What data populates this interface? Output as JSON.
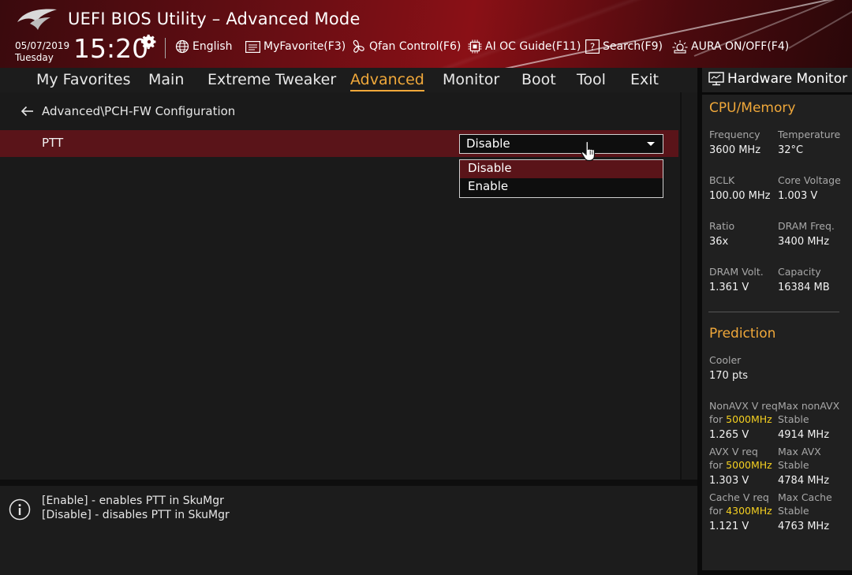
{
  "header": {
    "title": "UEFI BIOS Utility – Advanced Mode",
    "date": "05/07/2019",
    "day": "Tuesday",
    "time": "15:20",
    "tools": [
      {
        "label": "English",
        "icon": "globe-icon"
      },
      {
        "label": "MyFavorite(F3)",
        "icon": "favorite-list-icon"
      },
      {
        "label": "Qfan Control(F6)",
        "icon": "fan-icon"
      },
      {
        "label": "AI OC Guide(F11)",
        "icon": "chip-icon"
      },
      {
        "label": "Search(F9)",
        "icon": "help-search-icon"
      },
      {
        "label": "AURA ON/OFF(F4)",
        "icon": "aura-light-icon"
      }
    ]
  },
  "nav": {
    "tabs": [
      "My Favorites",
      "Main",
      "Extreme Tweaker",
      "Advanced",
      "Monitor",
      "Boot",
      "Tool",
      "Exit"
    ],
    "active": "Advanced"
  },
  "main": {
    "breadcrumb": "Advanced\\PCH-FW Configuration",
    "setting": {
      "label": "PTT",
      "value": "Disable",
      "options": [
        "Disable",
        "Enable"
      ],
      "highlighted_option": "Disable"
    }
  },
  "help": {
    "lines": [
      "[Enable] - enables PTT in SkuMgr",
      "[Disable] - disables PTT in SkuMgr"
    ]
  },
  "hardware_monitor": {
    "title": "Hardware Monitor",
    "cpu_memory": {
      "title": "CPU/Memory",
      "items": [
        {
          "label": "Frequency",
          "value": "3600 MHz"
        },
        {
          "label": "Temperature",
          "value": "32°C"
        },
        {
          "label": "BCLK",
          "value": "100.00 MHz"
        },
        {
          "label": "Core Voltage",
          "value": "1.003 V"
        },
        {
          "label": "Ratio",
          "value": "36x"
        },
        {
          "label": "DRAM Freq.",
          "value": "3400 MHz"
        },
        {
          "label": "DRAM Volt.",
          "value": "1.361 V"
        },
        {
          "label": "Capacity",
          "value": "16384 MB"
        }
      ]
    },
    "prediction": {
      "title": "Prediction",
      "cooler_label": "Cooler",
      "cooler_value": "170 pts",
      "rows": [
        {
          "left_label1": "NonAVX V req",
          "left_label2_prefix": "for ",
          "left_freq": "5000MHz",
          "left_value": "1.265 V",
          "right_label1": "Max nonAVX",
          "right_label2": "Stable",
          "right_value": "4914 MHz"
        },
        {
          "left_label1": "AVX V req",
          "left_label2_prefix": "for ",
          "left_freq": "5000MHz",
          "left_value": "1.303 V",
          "right_label1": "Max AVX",
          "right_label2": "Stable",
          "right_value": "4784 MHz"
        },
        {
          "left_label1": "Cache V req",
          "left_label2_prefix": "for ",
          "left_freq": "4300MHz",
          "left_value": "1.121 V",
          "right_label1": "Max Cache",
          "right_label2": "Stable",
          "right_value": "4763 MHz"
        }
      ]
    }
  },
  "colors": {
    "accent": "#f0a83a",
    "highlight_row": "#5a1419",
    "freq_highlight": "#f5d020"
  }
}
